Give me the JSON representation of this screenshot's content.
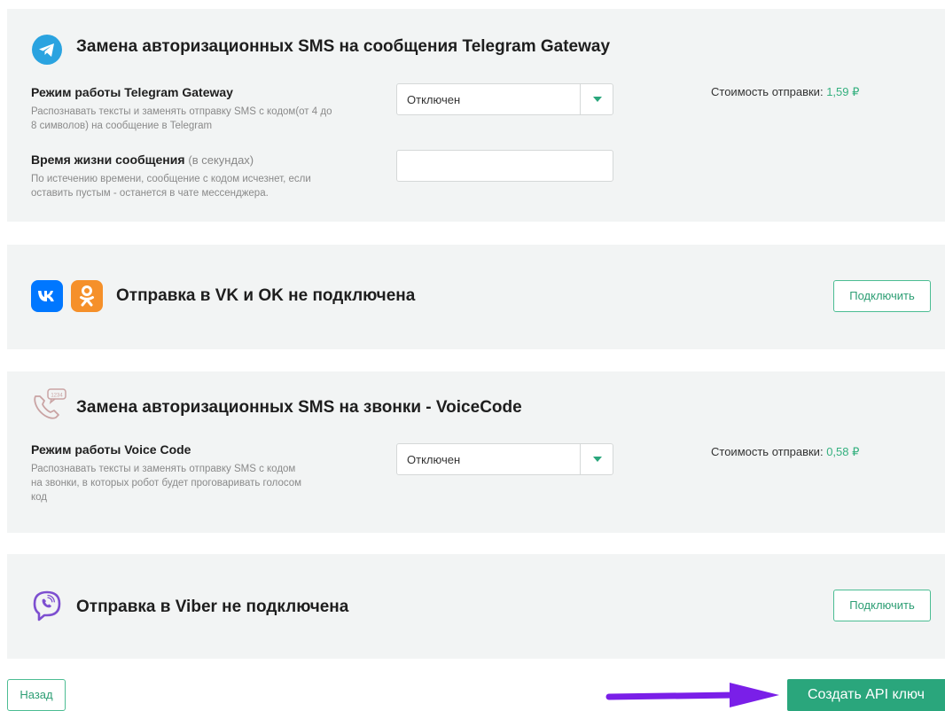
{
  "telegram": {
    "title": "Замена авторизационных SMS на сообщения Telegram Gateway",
    "mode_label": "Режим работы Telegram Gateway",
    "mode_hint": "Распознавать тексты и заменять отправку SMS с кодом(от 4 до 8 символов) на сообщение в Telegram",
    "mode_value": "Отключен",
    "cost_label": "Стоимость отправки:",
    "cost_value": "1,59 ₽",
    "ttl_label": "Время жизни сообщения",
    "ttl_unit": "(в секундах)",
    "ttl_hint": "По истечению времени, сообщение с кодом исчезнет, если оставить пустым - останется в чате мессенджера.",
    "ttl_value": ""
  },
  "vkok": {
    "title": "Отправка в VK и OK не подключена",
    "connect_label": "Подключить"
  },
  "voice": {
    "title": "Замена авторизационных SMS на звонки - VoiceCode",
    "mode_label": "Режим работы Voice Code",
    "mode_hint": "Распознавать тексты и заменять отправку SMS с кодом на звонки, в которых робот будет проговаривать голосом код",
    "mode_value": "Отключен",
    "cost_label": "Стоимость отправки:",
    "cost_value": "0,58 ₽",
    "icon_badge": "1234"
  },
  "viber": {
    "title": "Отправка в Viber не подключена",
    "connect_label": "Подключить"
  },
  "footer": {
    "back_label": "Назад",
    "create_label": "Создать API ключ"
  },
  "colors": {
    "accent": "#2aa67c",
    "panel_bg": "#f2f4f4",
    "arrow": "#7a1fe8",
    "telegram": "#2aa3e0",
    "vk": "#0077ff",
    "ok": "#f5902a",
    "viber": "#7d4fd0",
    "voice_icon": "#c9a3a3"
  },
  "icons": [
    "telegram-icon",
    "vk-icon",
    "ok-icon",
    "phone-message-icon",
    "viber-icon",
    "arrow-right-icon",
    "dropdown-caret-icon"
  ]
}
